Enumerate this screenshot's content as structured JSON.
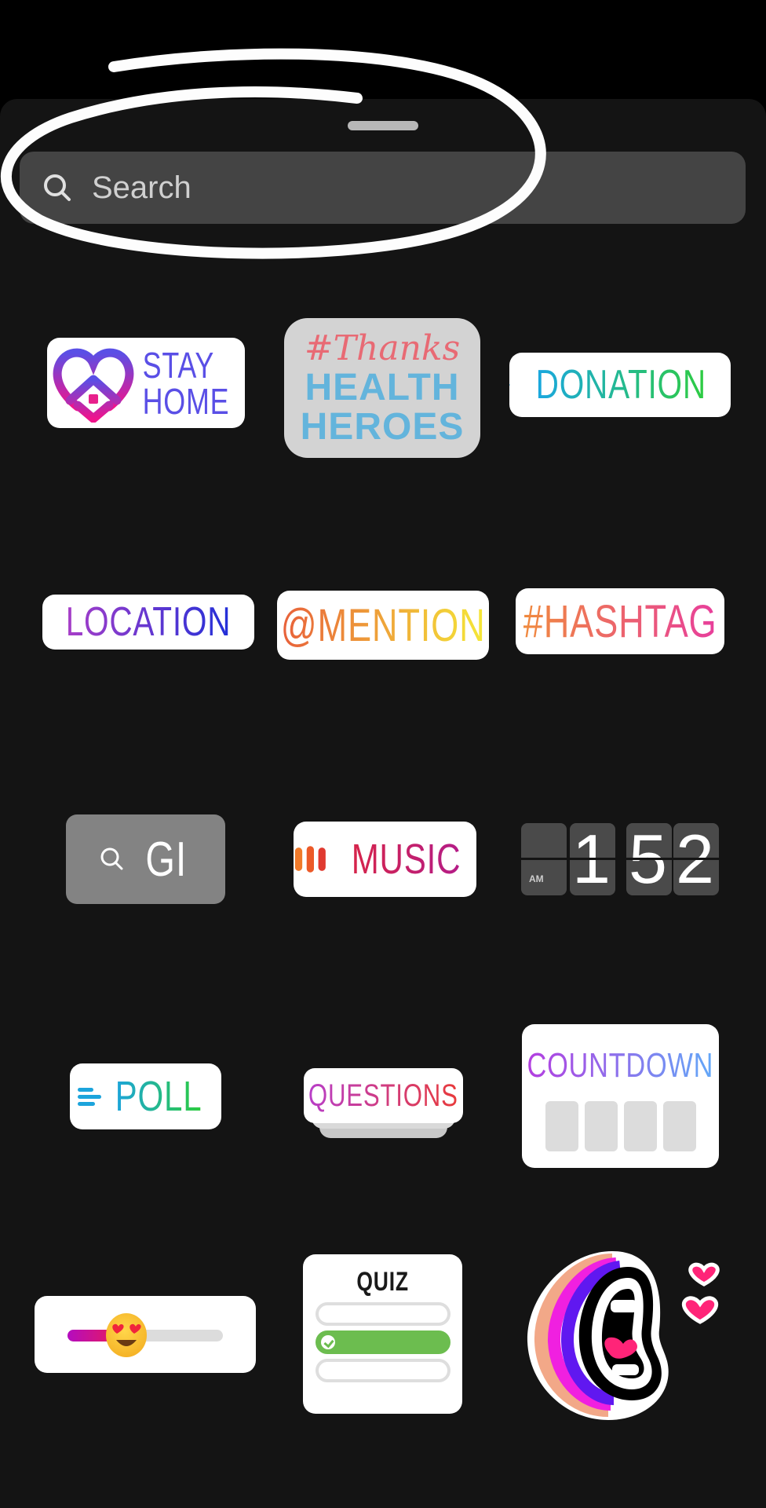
{
  "search": {
    "placeholder": "Search",
    "icon": "search-icon"
  },
  "annotation": {
    "type": "hand-drawn-circle",
    "color": "#ffffff",
    "target": "search-bar"
  },
  "stickers": {
    "stay_home": {
      "line1": "STAY",
      "line2": "HOME",
      "color": "#5a4fe6",
      "icon": "heart-house-icon"
    },
    "thanks_health_heroes": {
      "line1": "#Thanks",
      "line2": "HEALTH",
      "line3": "HEROES",
      "accent": "#e86a74",
      "color": "#63b4dc"
    },
    "donation": {
      "label": "DONATION",
      "icon": "heart-circle-icon"
    },
    "location": {
      "label": "LOCATION",
      "icon": "map-pin-icon"
    },
    "mention": {
      "label": "@MENTION"
    },
    "hashtag": {
      "label": "#HASHTAG"
    },
    "gif": {
      "label": "GIF",
      "shown_text": "GI",
      "icon": "search-icon"
    },
    "music": {
      "label": "MUSIC",
      "icon": "equalizer-icon"
    },
    "clock": {
      "period": "AM",
      "digits": [
        "",
        "1",
        "5",
        "2"
      ]
    },
    "poll": {
      "label": "POLL",
      "icon": "poll-lines-icon"
    },
    "questions": {
      "label": "QUESTIONS"
    },
    "countdown": {
      "label": "COUNTDOWN",
      "slots": 4
    },
    "emoji_slider": {
      "value": 0.38,
      "emoji": "heart-eyes-emoji"
    },
    "quiz": {
      "title": "QUIZ",
      "options": 3,
      "correct_index": 1
    },
    "mouth_sticker": {
      "icon": "shouting-mouth-hearts-icon"
    }
  }
}
